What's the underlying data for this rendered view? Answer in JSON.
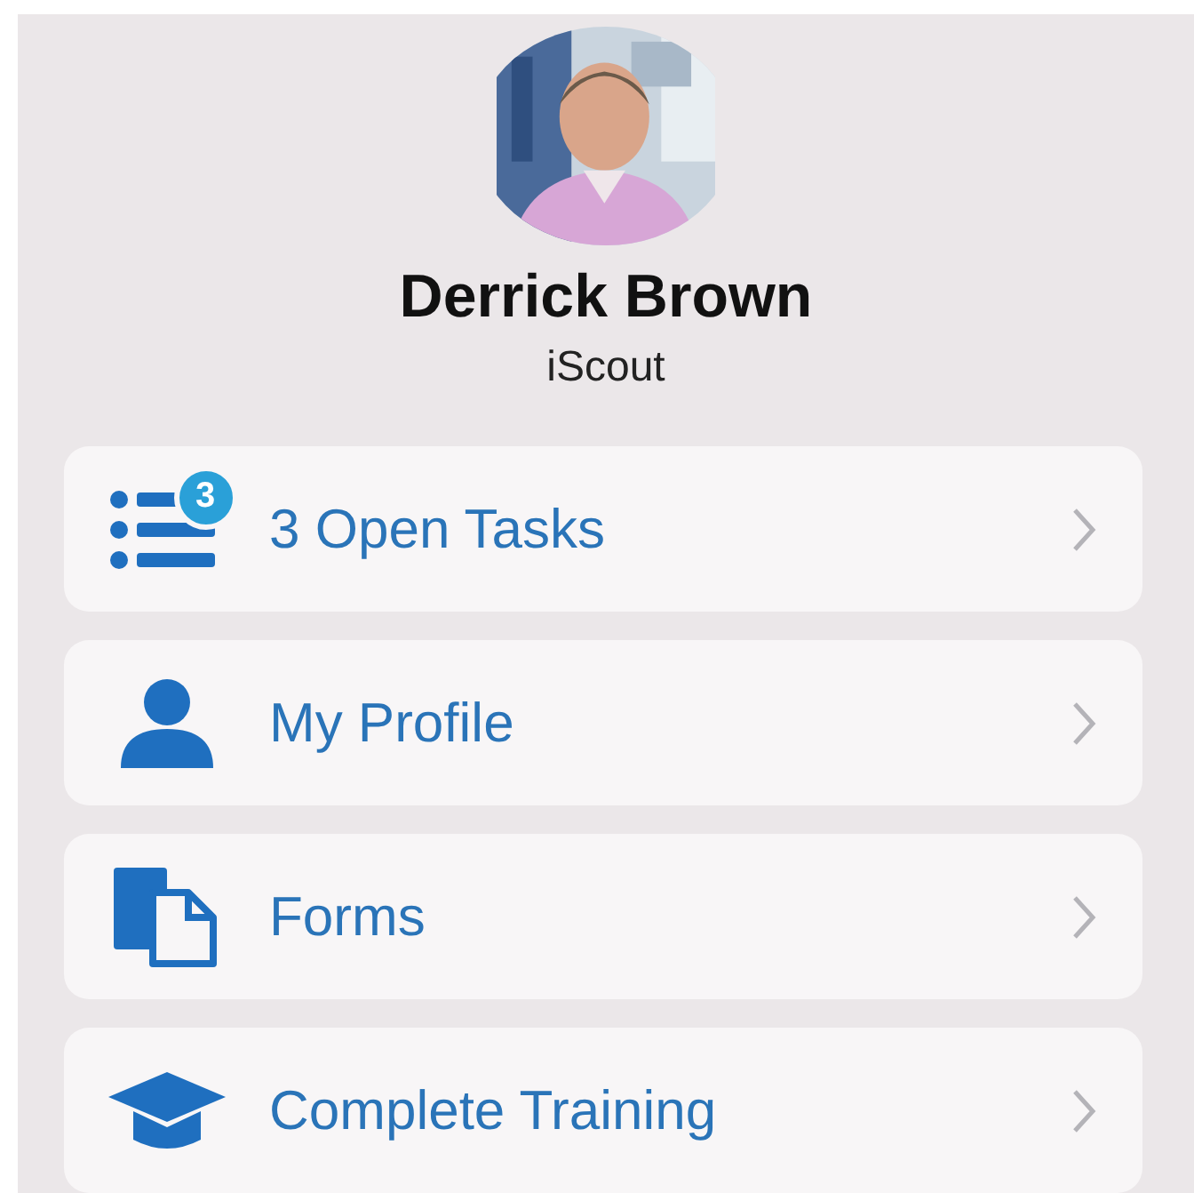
{
  "user": {
    "name": "Derrick Brown",
    "role": "iScout"
  },
  "menu": [
    {
      "kind": "tasks",
      "label": "3 Open Tasks",
      "badge": "3"
    },
    {
      "kind": "profile",
      "label": "My Profile"
    },
    {
      "kind": "forms",
      "label": "Forms"
    },
    {
      "kind": "training",
      "label": "Complete Training"
    }
  ]
}
